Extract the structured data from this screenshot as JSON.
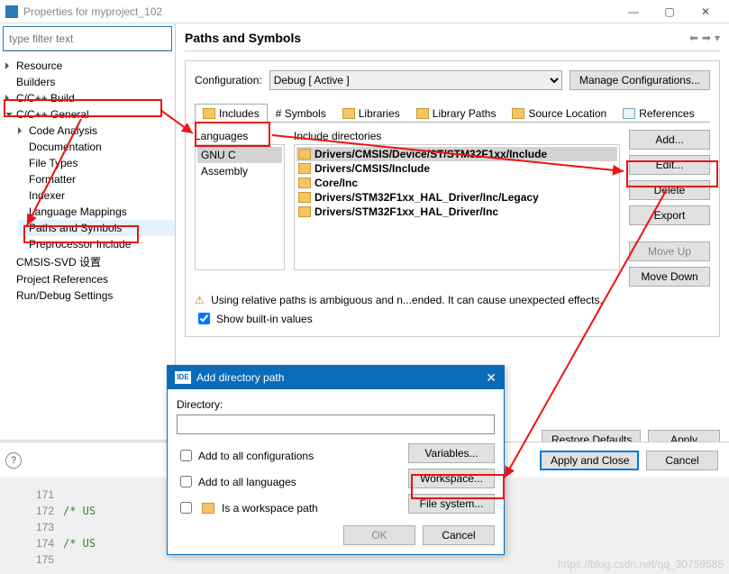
{
  "window": {
    "title": "Properties for myproject_102",
    "min": "—",
    "max": "▢",
    "close": "✕"
  },
  "filter_placeholder": "type filter text",
  "tree": {
    "resource": "Resource",
    "builders": "Builders",
    "cpp_build": "C/C++ Build",
    "cpp_general": "C/C++ General",
    "code_analysis": "Code Analysis",
    "documentation": "Documentation",
    "file_types": "File Types",
    "formatter": "Formatter",
    "indexer": "Indexer",
    "language_mappings": "Language Mappings",
    "paths_symbols": "Paths and Symbols",
    "preprocessor_include": "Preprocessor Include",
    "cmsis": "CMSIS-SVD 设置",
    "project_refs": "Project References",
    "run_debug": "Run/Debug Settings"
  },
  "page_title": "Paths and Symbols",
  "config": {
    "label": "Configuration:",
    "value": "Debug  [ Active ]",
    "manage": "Manage Configurations..."
  },
  "tabs": {
    "includes": "Includes",
    "symbols": "# Symbols",
    "libraries": "Libraries",
    "library_paths": "Library Paths",
    "source_location": "Source Location",
    "references": "References"
  },
  "langs": {
    "header": "Languages",
    "items": [
      "GNU C",
      "Assembly"
    ]
  },
  "includes": {
    "header": "Include directories",
    "items": [
      "Drivers/CMSIS/Device/ST/STM32F1xx/Include",
      "Drivers/CMSIS/Include",
      "Core/Inc",
      "Drivers/STM32F1xx_HAL_Driver/Inc/Legacy",
      "Drivers/STM32F1xx_HAL_Driver/Inc"
    ]
  },
  "sidebtns": {
    "add": "Add...",
    "edit": "Edit...",
    "delete": "Delete",
    "export": "Export",
    "move_up": "Move Up",
    "move_down": "Move Down"
  },
  "note_text": "Using relative paths is ambiguous and n...ended. It can cause unexpected effects.",
  "show_builtin": "Show built-in values",
  "bottom": {
    "restore": "Restore Defaults",
    "apply": "Apply",
    "apply_close": "Apply and Close",
    "cancel": "Cancel"
  },
  "dialog": {
    "title": "Add directory path",
    "dir_label": "Directory:",
    "dir_value": "",
    "add_all_conf": "Add to all configurations",
    "add_all_lang": "Add to all languages",
    "is_workspace": "Is a workspace path",
    "variables": "Variables...",
    "workspace": "Workspace...",
    "filesystem": "File system...",
    "ok": "OK",
    "cancel": "Cancel"
  },
  "code": {
    "l171": "171",
    "l172": "172",
    "l173": "173",
    "l174": "174",
    "l175": "175",
    "cmt": "/* US"
  },
  "watermark": "https://blog.csdn.net/qq_30759585"
}
